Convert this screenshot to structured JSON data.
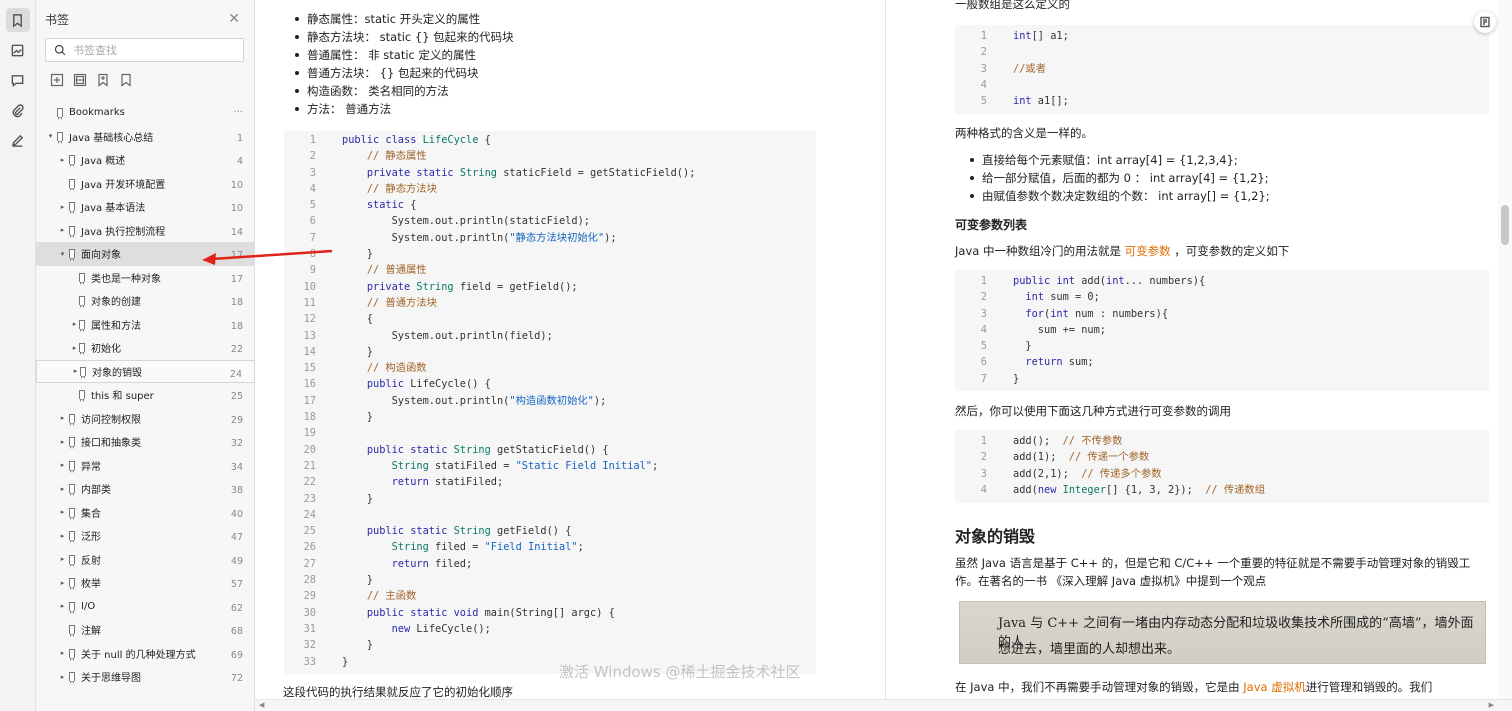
{
  "colors": {
    "accent_orange": "#e06c00",
    "arrow_red": "#e0241b",
    "selected_bg": "#dedede"
  },
  "rail": {
    "icons": [
      "bookmark-icon",
      "thumbnail-icon",
      "comment-icon",
      "attachment-icon",
      "signature-icon"
    ]
  },
  "panel": {
    "title": "书签",
    "search_placeholder": "书签查找",
    "tools": [
      "expand-all-icon",
      "collapse-all-icon",
      "add-bookmark-icon",
      "bookmark-outline-icon"
    ],
    "items": [
      {
        "label": "Bookmarks",
        "page": "...",
        "level": 0,
        "caret": ""
      },
      {
        "label": "Java 基础核心总结",
        "page": "1",
        "level": 0,
        "caret": "▾"
      },
      {
        "label": "Java 概述",
        "page": "4",
        "level": 1,
        "caret": "▸"
      },
      {
        "label": "Java 开发环境配置",
        "page": "10",
        "level": 1,
        "caret": ""
      },
      {
        "label": "Java 基本语法",
        "page": "10",
        "level": 1,
        "caret": "▸"
      },
      {
        "label": "Java 执行控制流程",
        "page": "14",
        "level": 1,
        "caret": "▸"
      },
      {
        "label": "面向对象",
        "page": "17",
        "level": 1,
        "caret": "▾"
      },
      {
        "label": "类也是一种对象",
        "page": "17",
        "level": 2,
        "caret": ""
      },
      {
        "label": "对象的创建",
        "page": "18",
        "level": 2,
        "caret": ""
      },
      {
        "label": "属性和方法",
        "page": "18",
        "level": 2,
        "caret": "▸"
      },
      {
        "label": "初始化",
        "page": "22",
        "level": 2,
        "caret": "▸"
      },
      {
        "label": "对象的销毁",
        "page": "24",
        "level": 2,
        "caret": "▸"
      },
      {
        "label": "this 和 super",
        "page": "25",
        "level": 2,
        "caret": ""
      },
      {
        "label": "访问控制权限",
        "page": "29",
        "level": 1,
        "caret": "▸"
      },
      {
        "label": "接口和抽象类",
        "page": "32",
        "level": 1,
        "caret": "▸"
      },
      {
        "label": "异常",
        "page": "34",
        "level": 1,
        "caret": "▸"
      },
      {
        "label": "内部类",
        "page": "38",
        "level": 1,
        "caret": "▸"
      },
      {
        "label": "集合",
        "page": "40",
        "level": 1,
        "caret": "▸"
      },
      {
        "label": "泛形",
        "page": "47",
        "level": 1,
        "caret": "▸"
      },
      {
        "label": "反射",
        "page": "49",
        "level": 1,
        "caret": "▸"
      },
      {
        "label": "枚举",
        "page": "57",
        "level": 1,
        "caret": "▸"
      },
      {
        "label": "I/O",
        "page": "62",
        "level": 1,
        "caret": "▸"
      },
      {
        "label": "注解",
        "page": "68",
        "level": 1,
        "caret": ""
      },
      {
        "label": "关于 null 的几种处理方式",
        "page": "69",
        "level": 1,
        "caret": "▸"
      },
      {
        "label": "关于思维导图",
        "page": "72",
        "level": 1,
        "caret": "▸"
      }
    ]
  },
  "left": {
    "bullets": [
      "静态属性：static 开头定义的属性",
      "静态方法块： static {} 包起来的代码块",
      "普通属性： 非 static 定义的属性",
      "普通方法块： {} 包起来的代码块",
      "构造函数： 类名相同的方法",
      "方法： 普通方法"
    ],
    "code": [
      "1|<span class=k>public class</span> <span class=t>LifeCycle</span> {",
      "2|    <span class=c>// 静态属性</span>",
      "3|    <span class=k>private static</span> <span class=t>String</span> staticField = getStaticField();",
      "4|    <span class=c>// 静态方法块</span>",
      "5|    <span class=k>static</span> {",
      "6|        System.out.println(staticField);",
      "7|        System.out.println(<span class=s>\"静态方法块初始化\"</span>);",
      "8|    }",
      "9|    <span class=c>// 普通属性</span>",
      "10|    <span class=k>private</span> <span class=t>String</span> field = getField();",
      "11|    <span class=c>// 普通方法块</span>",
      "12|    {",
      "13|        System.out.println(field);",
      "14|    }",
      "15|    <span class=c>// 构造函数</span>",
      "16|    <span class=k>public</span> LifeCycle() {",
      "17|        System.out.println(<span class=s>\"构造函数初始化\"</span>);",
      "18|    }",
      "19|",
      "20|    <span class=k>public static</span> <span class=t>String</span> getStaticField() {",
      "21|        <span class=t>String</span> statiFiled = <span class=s>\"Static Field Initial\"</span>;",
      "22|        <span class=k>return</span> statiFiled;",
      "23|    }",
      "24|",
      "25|    <span class=k>public static</span> <span class=t>String</span> getField() {",
      "26|        <span class=t>String</span> filed = <span class=s>\"Field Initial\"</span>;",
      "27|        <span class=k>return</span> filed;",
      "28|    }",
      "29|    <span class=c>// 主函数</span>",
      "30|    <span class=k>public static void</span> main(String[] argc) {",
      "31|        <span class=k>new</span> LifeCycle();",
      "32|    }",
      "33|}"
    ],
    "after_text": "这段代码的执行结果就反应了它的初始化顺序"
  },
  "right": {
    "intro": "一般数组是这么定义的",
    "code1": [
      "1|<span class=k>int</span>[] a1;",
      "2|",
      "3|<span class=c>//或者</span>",
      "4|",
      "5|<span class=k>int</span> a1[];"
    ],
    "same_meaning": "两种格式的含义是一样的。",
    "bullets": [
      "直接给每个元素赋值：int array[4] = {1,2,3,4};",
      "给一部分赋值，后面的都为 0 ： int array[4] = {1,2};",
      "由赋值参数个数决定数组的个数： int array[] = {1,2};"
    ],
    "varargs_heading": "可变参数列表",
    "varargs_pre": "Java 中一种数组冷门的用法就是 ",
    "varargs_term": "可变参数",
    "varargs_post": " ，可变参数的定义如下",
    "code2": [
      "1|<span class=k>public int</span> add(<span class=k>int</span>... numbers){",
      "2|  <span class=k>int</span> sum = 0;",
      "3|  <span class=k>for</span>(<span class=k>int</span> num : numbers){",
      "4|    sum += num;",
      "5|  }",
      "6|  <span class=k>return</span> sum;",
      "7|}"
    ],
    "then_text": "然后，你可以使用下面这几种方式进行可变参数的调用",
    "code3": [
      "1|add();  <span class=c>// 不传参数</span>",
      "2|add(1);  <span class=c>// 传递一个参数</span>",
      "3|add(2,1);  <span class=c>// 传递多个参数</span>",
      "4|add(<span class=k>new</span> <span class=t>Integer</span>[] {1, 3, 2});  <span class=c>// 传递数组</span>"
    ],
    "destroy_heading": "对象的销毁",
    "destroy_p1": "虽然 Java 语言是基于 C++ 的，但是它和 C/C++ 一个重要的特征就是不需要手动管理对象的销毁工",
    "destroy_p2": "作。在著名的一书 《深入理解 Java 虚拟机》中提到一个观点",
    "quote_line1": "Java 与 C++ 之间有一堵由内存动态分配和垃圾收集技术所围成的“高墙”，墙外面的人",
    "quote_line2": "想进去，墙里面的人却想出来。",
    "last_pre": "在 Java 中，我们不再需要手动管理对象的销毁，它是由 ",
    "last_term": "Java 虚拟机",
    "last_post": "进行管理和销毁的。我们"
  },
  "watermark": "激活 Windows  @稀土掘金技术社区"
}
